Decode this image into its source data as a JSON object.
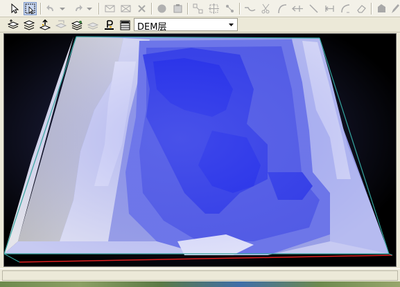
{
  "toolbar1": {
    "buttons": [
      {
        "name": "select-arrow-icon",
        "active": false
      },
      {
        "name": "select-box-icon",
        "active": true
      },
      {
        "name": "undo-icon",
        "active": false
      },
      {
        "name": "undo-dropdown-icon",
        "active": false
      },
      {
        "name": "redo-icon",
        "active": false
      },
      {
        "name": "redo-dropdown-icon",
        "active": false
      },
      {
        "name": "envelope-icon",
        "active": false
      },
      {
        "name": "envelope-x-icon",
        "active": false
      },
      {
        "name": "delete-x-icon",
        "active": false
      },
      {
        "name": "circle-icon",
        "active": false
      },
      {
        "name": "properties-icon",
        "active": false
      },
      {
        "name": "node-icon",
        "active": false
      },
      {
        "name": "vertex-edit-icon",
        "active": false
      },
      {
        "name": "split-icon",
        "active": false
      },
      {
        "name": "line-curve-icon",
        "active": false
      },
      {
        "name": "scissors-icon",
        "active": false
      },
      {
        "name": "arc-icon",
        "active": false
      },
      {
        "name": "extend-line-icon",
        "active": false
      },
      {
        "name": "diagonal-line-icon",
        "active": false
      },
      {
        "name": "trim-line-icon",
        "active": false
      },
      {
        "name": "arc-tool-icon",
        "active": false
      },
      {
        "name": "eraser-icon",
        "active": false
      },
      {
        "name": "shape-icon",
        "active": false
      },
      {
        "name": "pencil-icon",
        "active": false
      }
    ]
  },
  "toolbar2": {
    "buttons": [
      {
        "name": "layer-add-icon"
      },
      {
        "name": "layer-stack-icon"
      },
      {
        "name": "layer-up-icon"
      },
      {
        "name": "layer-grid-icon"
      },
      {
        "name": "layer-merge-icon"
      },
      {
        "name": "layer-copy-icon"
      },
      {
        "name": "layer-p-icon"
      },
      {
        "name": "layer-table-icon"
      }
    ],
    "layer_selector": {
      "value": "DEM层"
    }
  },
  "colors": {
    "terrain_dark_blue": "#1e28e8",
    "terrain_mid_blue": "#4a55e6",
    "terrain_light_blue": "#8590ea",
    "terrain_pale": "#c9ccf2",
    "terrain_gray": "#c4c4c8",
    "bounding_box": "#34a6a0",
    "base_edge": "#e02020"
  }
}
